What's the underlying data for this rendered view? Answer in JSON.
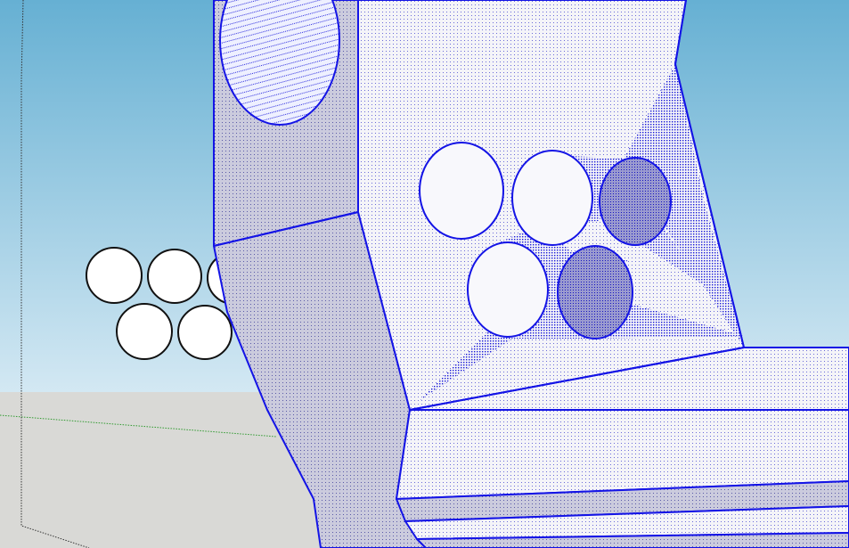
{
  "viewport": {
    "colors": {
      "sky_top": "#66b0d3",
      "sky_bottom": "#d3e8f3",
      "ground": "#d9d9d6",
      "selection_edge": "#1414e6",
      "face_front": "#f4f4f8",
      "face_side": "#cbcbdd",
      "face_shadow": "#b7b7cf",
      "axis_green": "#2f9a2f"
    },
    "icons": [
      "selected-model-icon",
      "circle-cluster-icon"
    ]
  }
}
